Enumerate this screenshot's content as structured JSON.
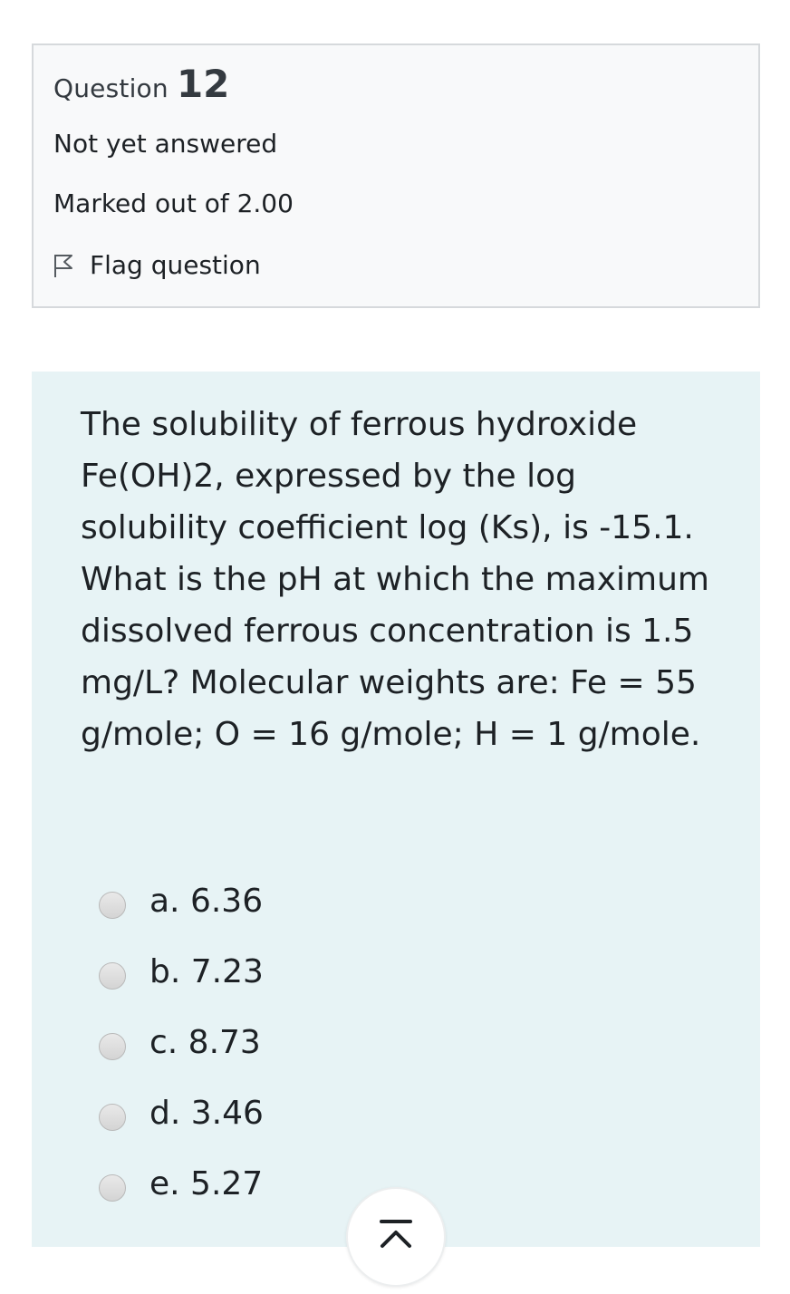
{
  "question_info": {
    "question_word": "Question",
    "question_number": "12",
    "state": "Not yet answered",
    "grade": "Marked out of 2.00",
    "flag_label": "Flag question",
    "flag_icon": "flag-outline-icon"
  },
  "question": {
    "text": "The solubility of ferrous hydroxide Fe(OH)2, expressed by the log solubility coefficient log (Ks), is -15.1. What is the pH at which the maximum dissolved ferrous concentration is 1.5 mg/L? Molecular weights are: Fe = 55 g/mole; O = 16 g/mole; H = 1 g/mole.",
    "answers": [
      {
        "label": "a. 6.36"
      },
      {
        "label": "b. 7.23"
      },
      {
        "label": "c. 8.73"
      },
      {
        "label": "d. 3.46"
      },
      {
        "label": "e. 5.27"
      }
    ]
  },
  "back_to_top": {
    "icon": "arrow-up-to-top-icon"
  },
  "colors": {
    "info_background": "#f8f9fa",
    "info_border": "#d6d9dc",
    "content_background": "#e7f3f5",
    "text": "#1d2125"
  }
}
